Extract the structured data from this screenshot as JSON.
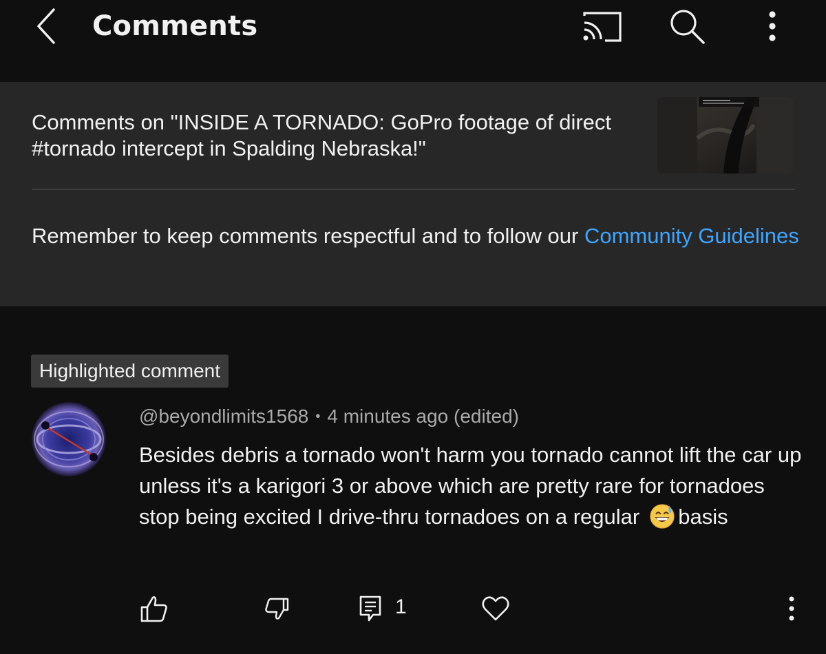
{
  "header": {
    "title": "Comments",
    "icons": [
      "back-icon",
      "cast-icon",
      "search-icon",
      "more-vert-icon"
    ]
  },
  "video": {
    "comments_on": "Comments on \"INSIDE A TORNADO: GoPro footage of direct #tornado intercept in Spalding Nebraska!\""
  },
  "guidelines": {
    "text": "Remember to keep comments respectful and to follow our ",
    "link": "Community Guidelines"
  },
  "comment": {
    "badge": "Highlighted comment",
    "author": "@beyondlimits1568",
    "separator": "•",
    "time": "4 minutes ago (edited)",
    "body": "Besides debris a tornado won't harm you tornado cannot lift the car up unless it's a karigori 3 or above which are pretty rare for tornadoes stop being excited I drive-thru tornadoes on a regular",
    "emoji": "grinning-face-with-sweat",
    "body_end": "basis",
    "reply_count": "1",
    "action_icons": [
      "thumbs-up-icon",
      "thumbs-down-icon",
      "reply-icon",
      "heart-icon",
      "more-vert-icon"
    ]
  },
  "colors": {
    "background": "#0f0f0f",
    "panel": "#272727",
    "link": "#3ea6ff",
    "badge": "#3a3a3a",
    "secondary_text": "#aaaaaa"
  }
}
